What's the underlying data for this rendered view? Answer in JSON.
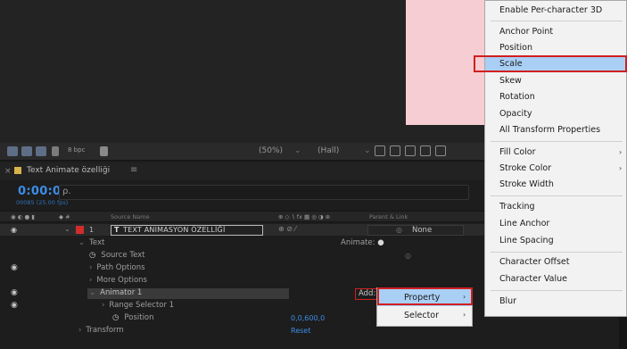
{
  "viewer": {
    "zoom": "(50%)",
    "resolution": "(Hall)",
    "fps_label": "8 bpc"
  },
  "panel": {
    "title": "Text Animate özelliği",
    "menu_glyph": "≡",
    "close_glyph": "×"
  },
  "timecode": {
    "value": "0:00:03:10",
    "fps": "00085 (25.00 fps)",
    "search_glyph": "ρ."
  },
  "columns": {
    "source_name": "Source Name",
    "parent": "Parent & Link"
  },
  "layer": {
    "number": "1",
    "type_glyph": "T",
    "name": "TEXT ANIMASYON ÖZELLİĞİ",
    "parent_value": "None"
  },
  "properties": {
    "text": "Text",
    "animate_label": "Animate:",
    "source_text": "Source Text",
    "path_options": "Path Options",
    "more_options": "More Options",
    "animator": "Animator 1",
    "add_label": "Add:",
    "range_selector": "Range Selector 1",
    "position": "Position",
    "position_value": "0,0,600,0",
    "transform": "Transform",
    "reset": "Reset"
  },
  "main_menu": {
    "items": [
      "Enable Per-character 3D",
      "Anchor Point",
      "Position",
      "Scale",
      "Skew",
      "Rotation",
      "Opacity",
      "All Transform Properties",
      "Fill Color",
      "Stroke Color",
      "Stroke Width",
      "Tracking",
      "Line Anchor",
      "Line Spacing",
      "Character Offset",
      "Character Value",
      "Blur"
    ],
    "highlighted": "Scale",
    "submenu_arrow": "›"
  },
  "sub_menu": {
    "items": [
      "Property",
      "Selector"
    ],
    "highlighted": "Property",
    "arrow": "›"
  },
  "colors": {
    "highlight_bg": "#a9cff5",
    "highlight_border": "#d11f1f",
    "timecode": "#3b8ee8",
    "layer_label": "#d22d2d",
    "pink_layer": "#f6cdd2"
  }
}
